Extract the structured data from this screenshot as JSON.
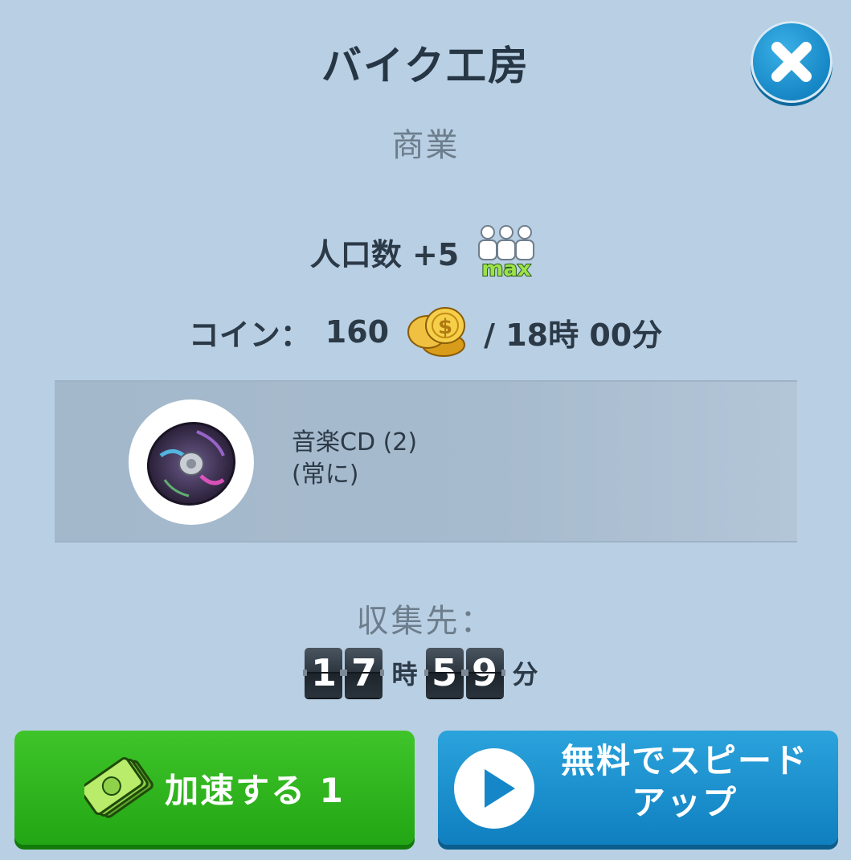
{
  "dialog": {
    "title": "バイク工房",
    "category": "商業",
    "close_icon": "close-icon"
  },
  "population": {
    "label": "人口数 +5",
    "badge": "max"
  },
  "coin": {
    "label": "コイン：",
    "amount": "160",
    "time": "/ 18時 00分"
  },
  "item": {
    "name": "音楽CD (2)",
    "frequency": "(常に)"
  },
  "collect": {
    "label": "収集先：",
    "hour_digits": [
      "1",
      "7"
    ],
    "hour_unit": "時",
    "minute_digits": [
      "5",
      "9"
    ],
    "minute_unit": "分"
  },
  "buttons": {
    "speed_up": "加速する 1",
    "free_line1": "無料でスピード",
    "free_line2": "アップ"
  },
  "colors": {
    "background": "#b9cfe3",
    "close_button": "#1f95d3",
    "speed_button": "#2bb31b",
    "free_button": "#1a8fcc"
  }
}
